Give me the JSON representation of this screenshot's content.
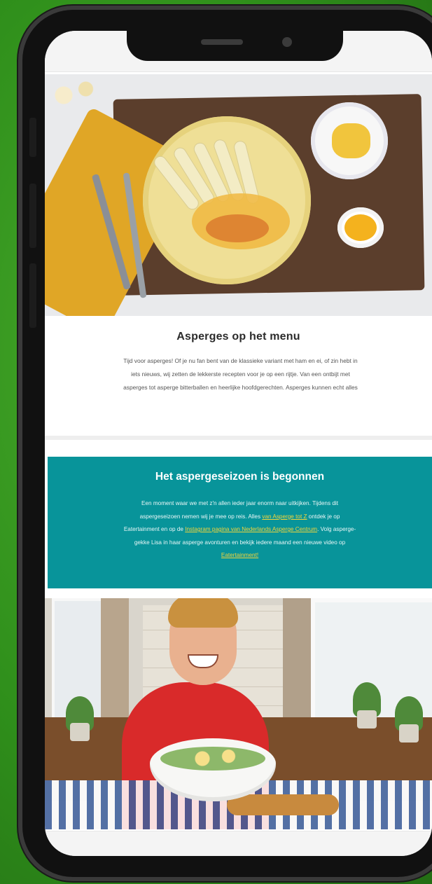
{
  "article": {
    "title": "Asperges op het menu",
    "body_lines": [
      "Tijd voor asperges! Of je nu fan bent van de klassieke variant met ham en ei, of zin hebt in",
      "iets nieuws, wij zetten de lekkerste recepten voor je op een rijtje. Van een ontbijt met",
      "asperges tot asperge bitterballen en heerlijke hoofdgerechten. Asperges kunnen echt alles"
    ]
  },
  "promo": {
    "title": "Het aspergeseizoen is begonnen",
    "line1": "Een moment waar we met z'n allen ieder jaar enorm naar uitkijken. Tijdens dit",
    "line2_pre": "aspergeseizoen nemen wij je mee op reis. Alles ",
    "link1": "van Asperge tot Z",
    "line2_post": " ontdek je op",
    "line3_pre": "Eatertainment en op de ",
    "link2": "Instagram pagina van Nederlands Asperge Centrum",
    "line3_post": ". Volg asperge-",
    "line4": "gekke Lisa in haar asperge avonturen en bekijk iedere maand een nieuwe video op",
    "link3": "Eatertainment!"
  },
  "colors": {
    "background": "#2f8f1b",
    "promo_teal": "#08949a",
    "link_yellow": "#f2d43b"
  }
}
